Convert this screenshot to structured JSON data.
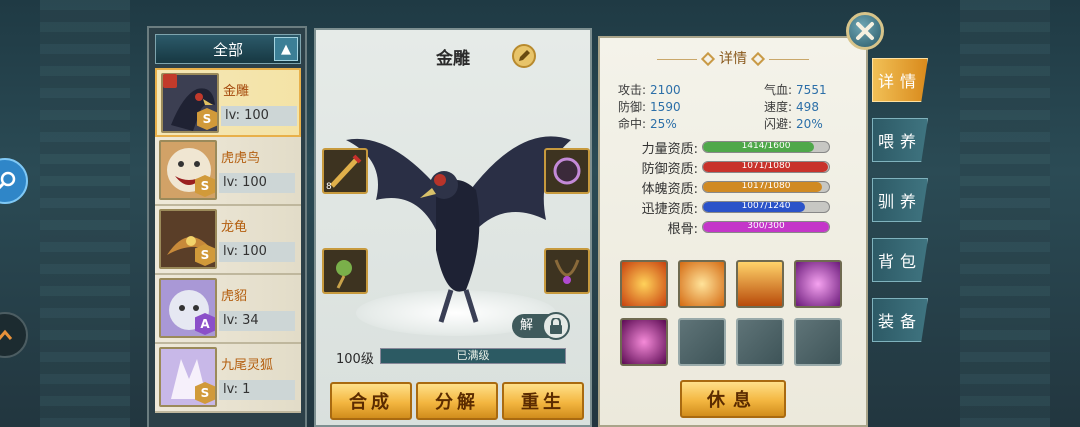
{
  "list": {
    "filter_label": "全部",
    "pets": [
      {
        "name": "金雕",
        "level": "lv: 100",
        "grade": "S"
      },
      {
        "name": "虎虎鸟",
        "level": "lv: 100",
        "grade": "S"
      },
      {
        "name": "龙龟",
        "level": "lv: 100",
        "grade": "S"
      },
      {
        "name": "虎貂",
        "level": "lv: 34",
        "grade": "A"
      },
      {
        "name": "九尾灵狐",
        "level": "lv: 1",
        "grade": "S"
      }
    ]
  },
  "center": {
    "pet_name": "金雕",
    "unlock_label": "解",
    "slot_count": "8",
    "level_label": "100级",
    "level_status": "已满级",
    "buttons": {
      "combine": "合成",
      "decompose": "分解",
      "rebirth": "重生"
    }
  },
  "detail": {
    "title": "详情",
    "stats": {
      "attack_k": "攻击:",
      "attack_v": "2100",
      "hp_k": "气血:",
      "hp_v": "7551",
      "defense_k": "防御:",
      "defense_v": "1590",
      "speed_k": "速度:",
      "speed_v": "498",
      "hit_k": "命中:",
      "hit_v": "25%",
      "dodge_k": "闪避:",
      "dodge_v": "20%"
    },
    "aptitudes": [
      {
        "label": "力量资质:",
        "text": "1414/1600",
        "fraction": 0.884,
        "color": "#4fa84a"
      },
      {
        "label": "防御资质:",
        "text": "1071/1080",
        "fraction": 0.992,
        "color": "#c8322b"
      },
      {
        "label": "体魄资质:",
        "text": "1017/1080",
        "fraction": 0.942,
        "color": "#d08a23"
      },
      {
        "label": "迅捷资质:",
        "text": "1007/1240",
        "fraction": 0.812,
        "color": "#2b53c9"
      },
      {
        "label": "根骨:",
        "text": "300/300",
        "fraction": 1.0,
        "color": "#c436c9"
      }
    ],
    "rest_label": "休息"
  },
  "tabs": {
    "detail": "详情",
    "feed": "喂养",
    "train": "驯养",
    "bag": "背包",
    "equip": "装备"
  }
}
